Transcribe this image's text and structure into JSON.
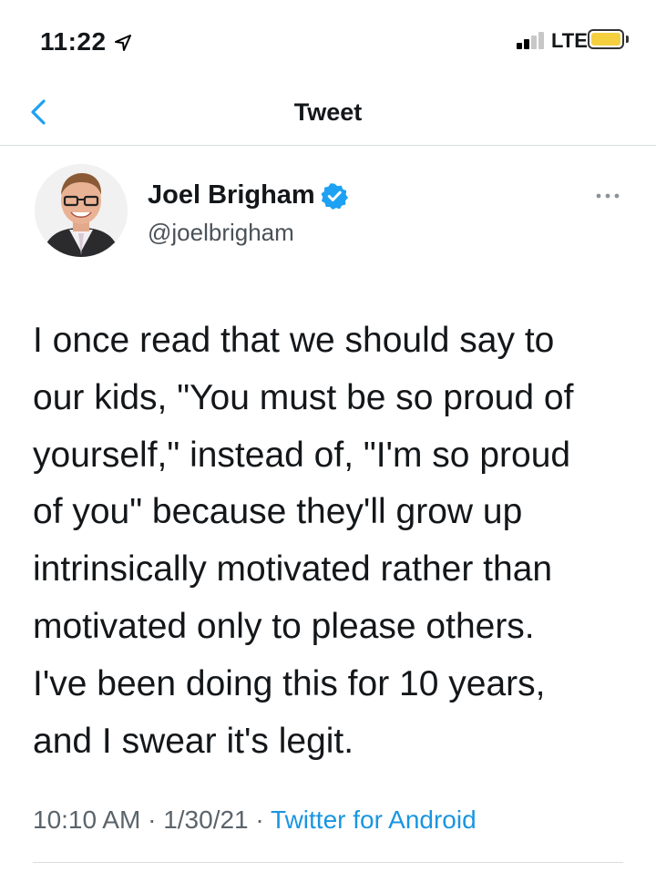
{
  "status_bar": {
    "time": "11:22",
    "network": "LTE"
  },
  "nav": {
    "title": "Tweet"
  },
  "tweet": {
    "author": {
      "display_name": "Joel Brigham",
      "handle": "@joelbrigham"
    },
    "lines": [
      "I once read that we should say to",
      "our kids, \"You must be so proud of",
      "yourself,\" instead of, \"I'm so proud",
      "of you\" because they'll grow up",
      "intrinsically motivated rather than",
      "motivated only to please others.",
      "I've been doing this for 10 years,",
      "and I swear it's legit."
    ],
    "time": "10:10 AM",
    "separator": " · ",
    "date": "1/30/21",
    "source": "Twitter for Android"
  },
  "colors": {
    "accent": "#1da1f2",
    "text": "#14171a",
    "secondary_text": "#5b646b"
  }
}
